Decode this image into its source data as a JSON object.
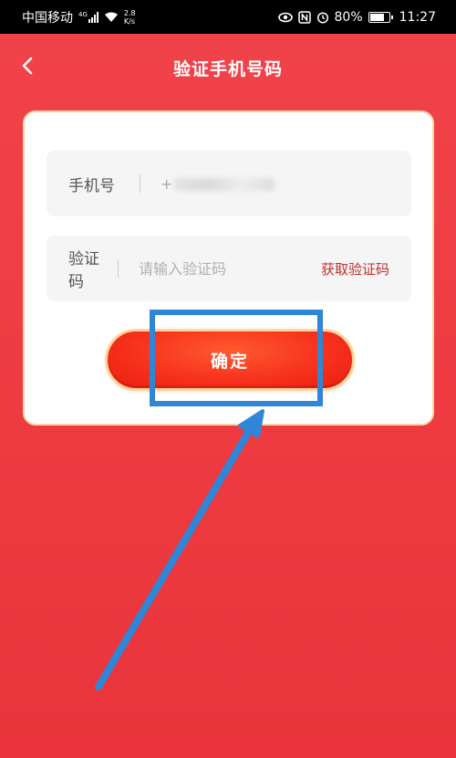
{
  "status_bar": {
    "carrier": "中国移动",
    "network_type": "4G",
    "speed_value": "2.8",
    "speed_unit": "K/s",
    "battery": "80%",
    "time": "11:27",
    "icons": [
      "signal-icon",
      "wifi-icon",
      "eye-icon",
      "nfc-icon",
      "alarm-icon",
      "battery-icon"
    ]
  },
  "header": {
    "back_icon": "chevron-left-icon",
    "title": "验证手机号码"
  },
  "form": {
    "phone_label": "手机号",
    "phone_value_prefix": "+",
    "code_label": "验证码",
    "code_placeholder": "请输入验证码",
    "get_code_label": "获取验证码",
    "confirm_label": "确定"
  },
  "colors": {
    "background": "#ef3e43",
    "accent": "#f7321d",
    "link": "#c0302b",
    "annotation": "#2f86d6"
  },
  "battery_level": 0.8
}
